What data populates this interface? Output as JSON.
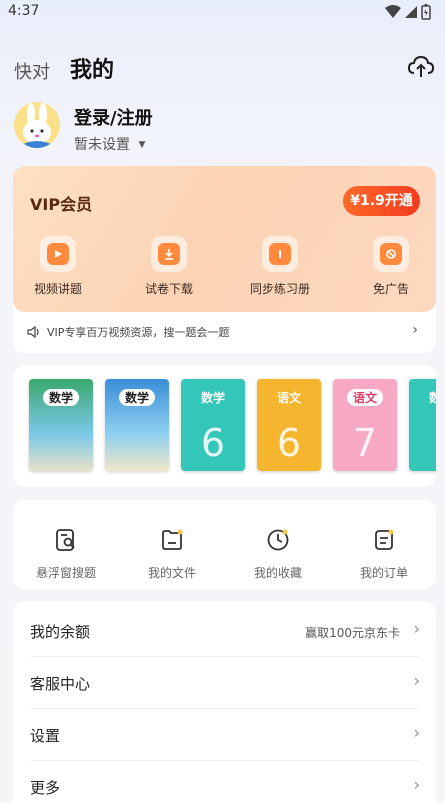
{
  "status": {
    "time": "4:37"
  },
  "nav": {
    "tab_kuaidui": "快对",
    "tab_mine": "我的",
    "upload_icon": "cloud-upload-icon"
  },
  "profile": {
    "login_label": "登录/注册",
    "sub_label": "暂未设置"
  },
  "vip": {
    "title": "VIP会员",
    "button_label": "¥1.9开通",
    "features": [
      {
        "label": "视频讲题",
        "icon": "play-icon"
      },
      {
        "label": "试卷下载",
        "icon": "download-icon"
      },
      {
        "label": "同步练习册",
        "icon": "workbook-icon"
      },
      {
        "label": "免广告",
        "icon": "no-ads-icon"
      }
    ],
    "tip": "VIP专享百万视频资源，搜一题会一题"
  },
  "books": [
    {
      "title": "数学",
      "color": "#2fa36a"
    },
    {
      "title": "数学",
      "color": "#3a8ed8"
    },
    {
      "title": "数学",
      "color": "#34c6b8"
    },
    {
      "title": "语文",
      "color": "#f6b52f"
    },
    {
      "title": "语文",
      "color": "#f27da6"
    },
    {
      "title": "数学",
      "color": "#34c6b8"
    }
  ],
  "tools": [
    {
      "label": "悬浮窗搜题",
      "icon": "floating-search-icon"
    },
    {
      "label": "我的文件",
      "icon": "folder-icon"
    },
    {
      "label": "我的收藏",
      "icon": "clock-icon"
    },
    {
      "label": "我的订单",
      "icon": "order-icon"
    }
  ],
  "menu": [
    {
      "label": "我的余额",
      "extra": "赢取100元京东卡"
    },
    {
      "label": "客服中心",
      "extra": ""
    },
    {
      "label": "设置",
      "extra": ""
    },
    {
      "label": "更多",
      "extra": ""
    }
  ],
  "colors": {
    "accent": "#f2461f",
    "vip_bg": "#fcd3b4"
  }
}
